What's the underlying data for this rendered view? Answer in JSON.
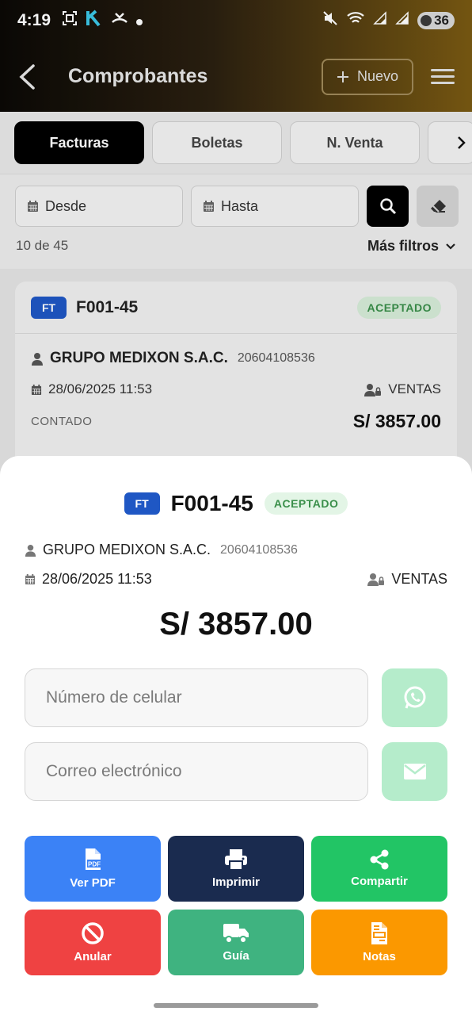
{
  "status_bar": {
    "time": "4:19",
    "battery": "36"
  },
  "header": {
    "title": "Comprobantes",
    "new_button": "Nuevo"
  },
  "tabs": [
    {
      "label": "Facturas",
      "active": true
    },
    {
      "label": "Boletas",
      "active": false
    },
    {
      "label": "N. Venta",
      "active": false
    }
  ],
  "filters": {
    "from_placeholder": "Desde",
    "to_placeholder": "Hasta",
    "count": "10 de 45",
    "more_filters": "Más filtros"
  },
  "list_card": {
    "type": "FT",
    "number": "F001-45",
    "status": "ACEPTADO",
    "client": "GRUPO MEDIXON S.A.C.",
    "ruc": "20604108536",
    "datetime": "28/06/2025 11:53",
    "area": "VENTAS",
    "payment": "CONTADO",
    "total": "S/ 3857.00"
  },
  "sheet": {
    "type": "FT",
    "number": "F001-45",
    "status": "ACEPTADO",
    "client": "GRUPO MEDIXON S.A.C.",
    "ruc": "20604108536",
    "datetime": "28/06/2025 11:53",
    "area": "VENTAS",
    "total": "S/ 3857.00",
    "phone_placeholder": "Número de celular",
    "email_placeholder": "Correo electrónico",
    "actions": [
      {
        "label": "Ver PDF",
        "color": "#3b82f6"
      },
      {
        "label": "Imprimir",
        "color": "#1a2b4f"
      },
      {
        "label": "Compartir",
        "color": "#22c565"
      },
      {
        "label": "Anular",
        "color": "#ef4242"
      },
      {
        "label": "Guía",
        "color": "#3fb380"
      },
      {
        "label": "Notas",
        "color": "#fb9800"
      }
    ]
  },
  "colors": {
    "invoice_badge": "#1f57c4",
    "accepted_bg": "#d6ecd9",
    "accepted_text": "#3a8f4a",
    "whatsapp_btn": "#b5eccb"
  }
}
